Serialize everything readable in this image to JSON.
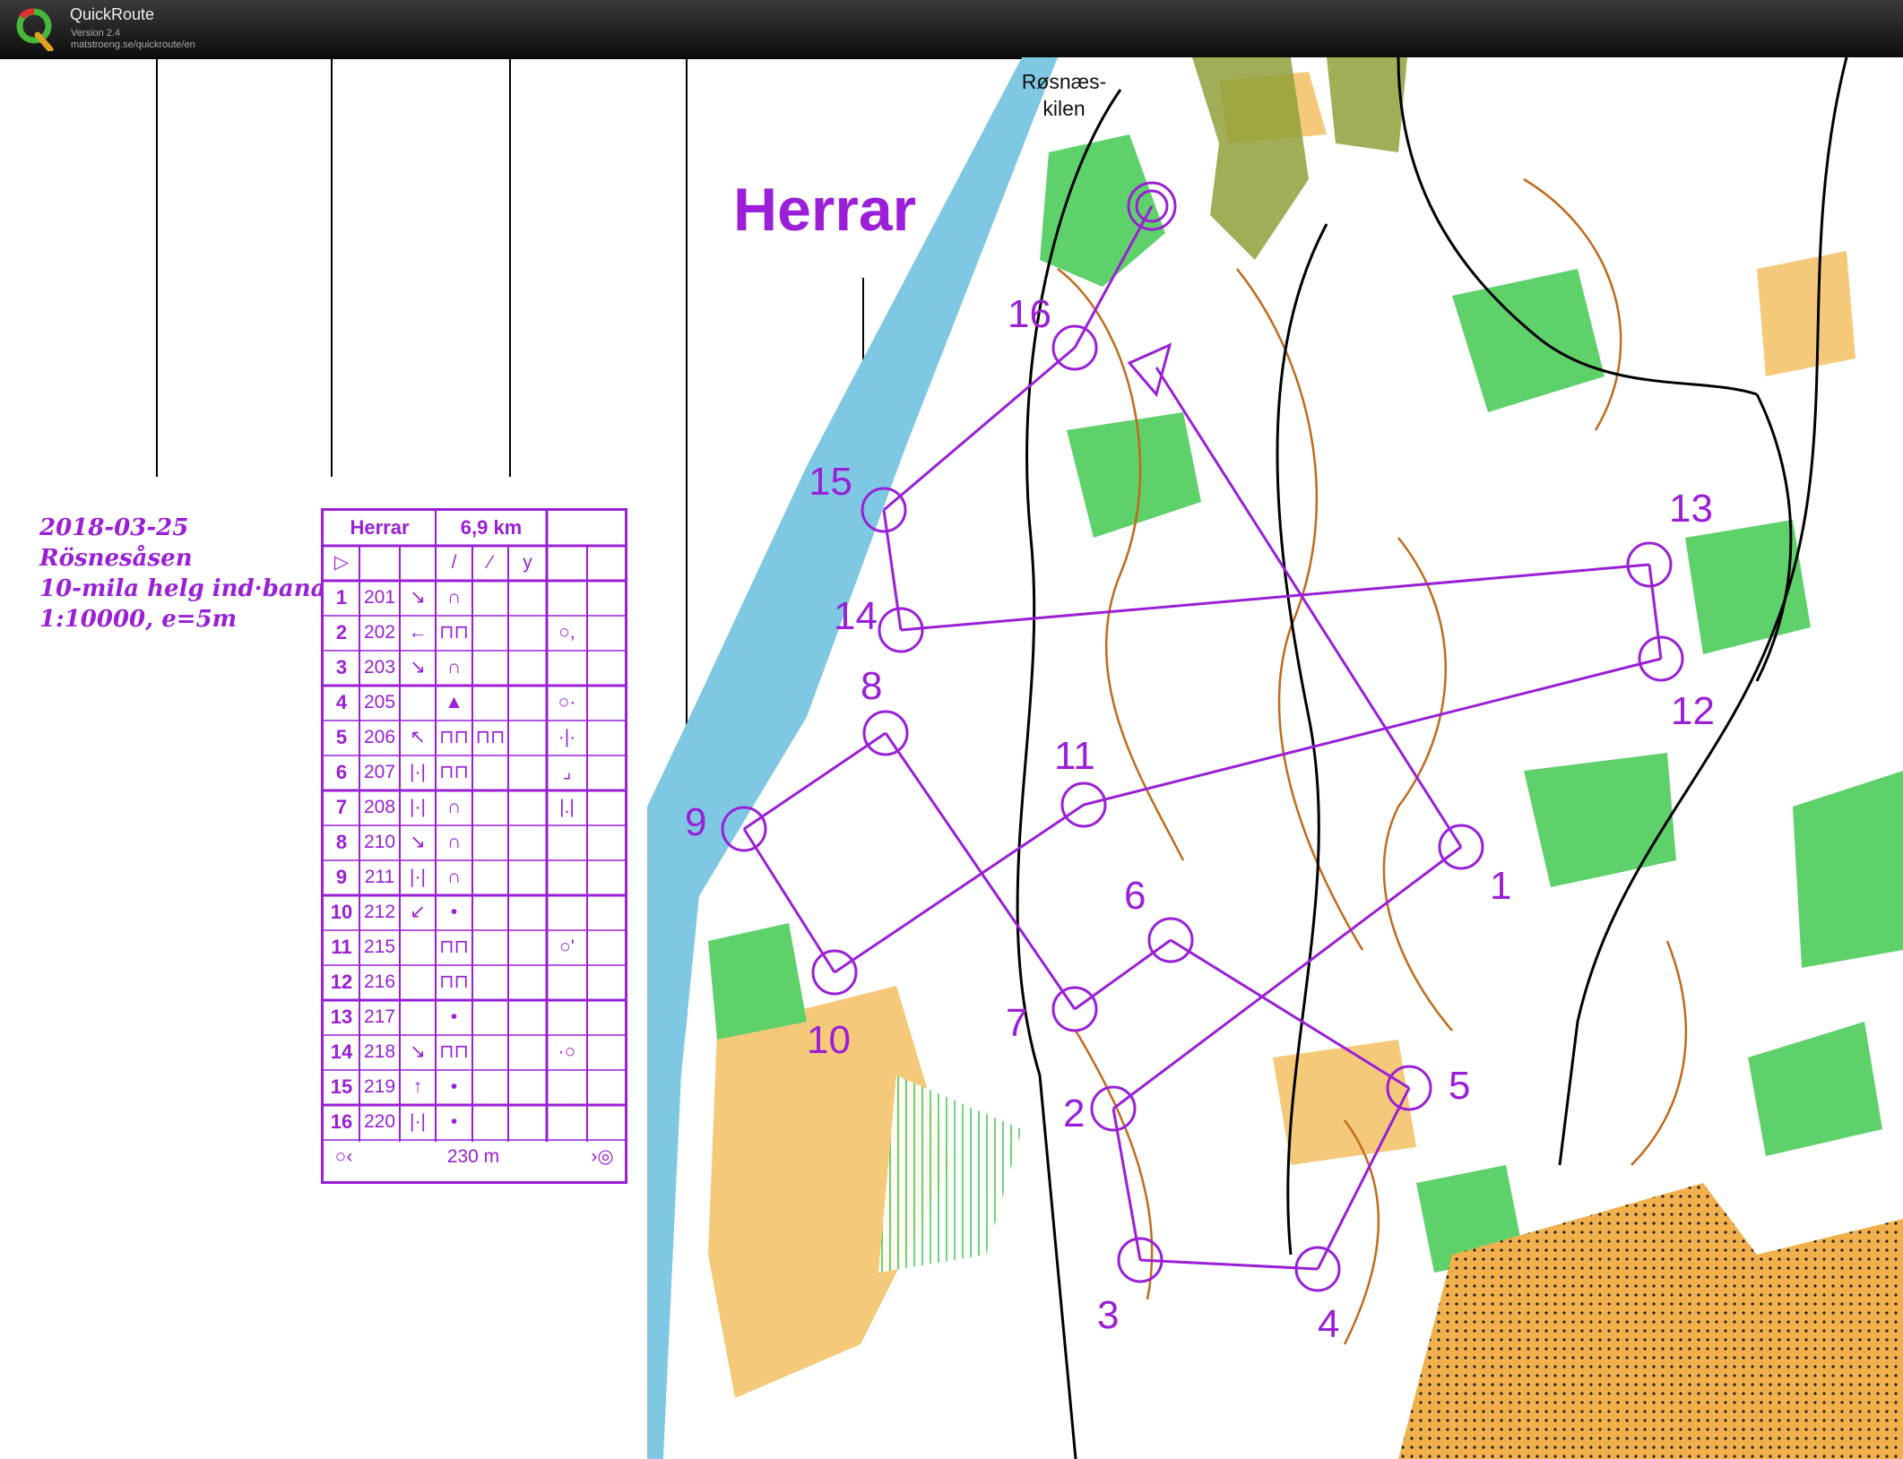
{
  "app": {
    "name": "QuickRoute",
    "version": "Version 2.4",
    "url": "matstroeng.se/quickroute/en"
  },
  "map": {
    "course_title": "Herrar",
    "place_name_line1": "Røsnæs-",
    "place_name_line2": "kilen",
    "notes": [
      "2018-03-25",
      "Rösnesåsen",
      "10-mila helg ind·bana",
      "1:10000, e=5m"
    ],
    "controls": [
      "1",
      "2",
      "3",
      "4",
      "5",
      "6",
      "7",
      "8",
      "9",
      "10",
      "11",
      "12",
      "13",
      "14",
      "15",
      "16"
    ],
    "colors": {
      "course": "#9a1fd6",
      "water": "#7ec8e3",
      "forest_white": "#ffffff",
      "green": "#5fd16a",
      "open": "#f5c97a",
      "contour": "#c26a1c"
    }
  },
  "descriptions": {
    "course": "Herrar",
    "length": "6,9 km",
    "rows": [
      {
        "n": "1",
        "code": "201",
        "dir": "↘",
        "feat": "∩",
        "extra": ""
      },
      {
        "n": "2",
        "code": "202",
        "dir": "←",
        "feat": "⊓⊓",
        "extra": "○,"
      },
      {
        "n": "3",
        "code": "203",
        "dir": "↘",
        "feat": "∩",
        "extra": ""
      },
      {
        "n": "4",
        "code": "205",
        "dir": "",
        "feat": "▲",
        "extra": "○·"
      },
      {
        "n": "5",
        "code": "206",
        "dir": "↖",
        "feat": "⊓⊓",
        "extra2": "⊓⊓",
        "extra": "·|·"
      },
      {
        "n": "6",
        "code": "207",
        "dir": "|·|",
        "feat": "⊓⊓",
        "extra": "⌟"
      },
      {
        "n": "7",
        "code": "208",
        "dir": "|·|",
        "feat": "∩",
        "extra": "|.|"
      },
      {
        "n": "8",
        "code": "210",
        "dir": "↘",
        "feat": "∩",
        "extra": ""
      },
      {
        "n": "9",
        "code": "211",
        "dir": "|·|",
        "feat": "∩",
        "extra": ""
      },
      {
        "n": "10",
        "code": "212",
        "dir": "↙",
        "feat": "•",
        "extra": ""
      },
      {
        "n": "11",
        "code": "215",
        "dir": "",
        "feat": "⊓⊓",
        "extra": "○'"
      },
      {
        "n": "12",
        "code": "216",
        "dir": "",
        "feat": "⊓⊓",
        "extra": ""
      },
      {
        "n": "13",
        "code": "217",
        "dir": "",
        "feat": "•",
        "extra": ""
      },
      {
        "n": "14",
        "code": "218",
        "dir": "↘",
        "feat": "⊓⊓",
        "extra": "·○"
      },
      {
        "n": "15",
        "code": "219",
        "dir": "↑",
        "feat": "•",
        "extra": ""
      },
      {
        "n": "16",
        "code": "220",
        "dir": "|·|",
        "feat": "•",
        "extra": ""
      }
    ],
    "finish_distance": "230 m"
  }
}
